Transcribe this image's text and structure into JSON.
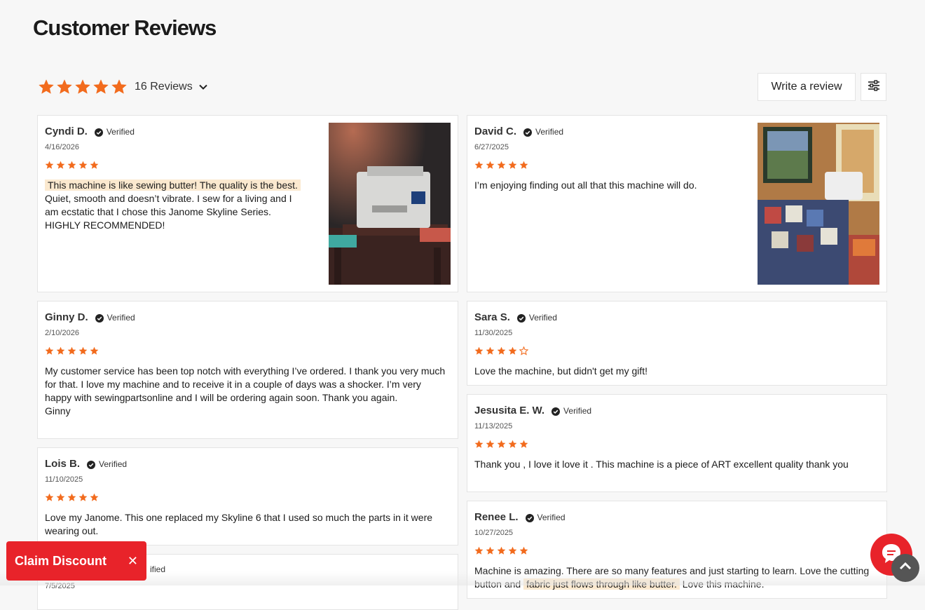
{
  "section": {
    "title": "Customer Reviews"
  },
  "summary": {
    "rating": 5,
    "count_label": "16 Reviews"
  },
  "actions": {
    "write_label": "Write a review"
  },
  "verified_label": "Verified",
  "reviews": [
    {
      "name": "Cyndi D.",
      "date": "4/16/2026",
      "rating": 5,
      "highlight": "This machine is like sewing butter! The quality is the best.",
      "text": "Quiet, smooth and doesn’t vibrate. I sew for a living and I am ecstatic that I chose this Janome Skyline Series. HIGHLY RECOMMENDED!"
    },
    {
      "name": "David C.",
      "date": "6/27/2025",
      "rating": 5,
      "text": "I’m enjoying finding out all that this machine will do."
    },
    {
      "name": "Ginny D.",
      "date": "2/10/2026",
      "rating": 5,
      "text": "My customer service has been top notch with everything I’ve ordered.  I thank you very much for that.  I love my machine and to receive it in a couple of days was a shocker.  I’m very happy with sewingpartsonline and I will be ordering again soon.  Thank you again.",
      "sign": "Ginny"
    },
    {
      "name": "Sara S.",
      "date": "11/30/2025",
      "rating": 4,
      "text": "Love the machine,  but didn't get my gift!"
    },
    {
      "name": "Jesusita E. W.",
      "date": "11/13/2025",
      "rating": 5,
      "text": "Thank you , I love it love it . This machine is a piece of ART excellent quality thank you"
    },
    {
      "name": "Lois B.",
      "date": "11/10/2025",
      "rating": 5,
      "text": "Love my Janome. This one replaced my Skyline 6 that I used so much the parts in it were wearing out."
    },
    {
      "name": "Renee L.",
      "date": "10/27/2025",
      "rating": 5,
      "text_before": "Machine is amazing.  There are so many features and just starting to learn.  Love the cutting button and",
      "highlight": "fabric just flows through like butter.",
      "text_after": "Love this machine."
    },
    {
      "date": "7/5/2025",
      "verified_fragment": "ified"
    }
  ],
  "promo": {
    "claim_label": "Claim Discount",
    "close_glyph": "✕"
  },
  "colors": {
    "star": "#f26b1d",
    "accent": "#e8232a",
    "highlight": "#fbe9cf"
  },
  "icons": {
    "star": "star-icon",
    "verified": "check-circle-icon",
    "filter": "sliders-icon",
    "chat": "chat-icon",
    "top": "chevron-up-icon"
  }
}
